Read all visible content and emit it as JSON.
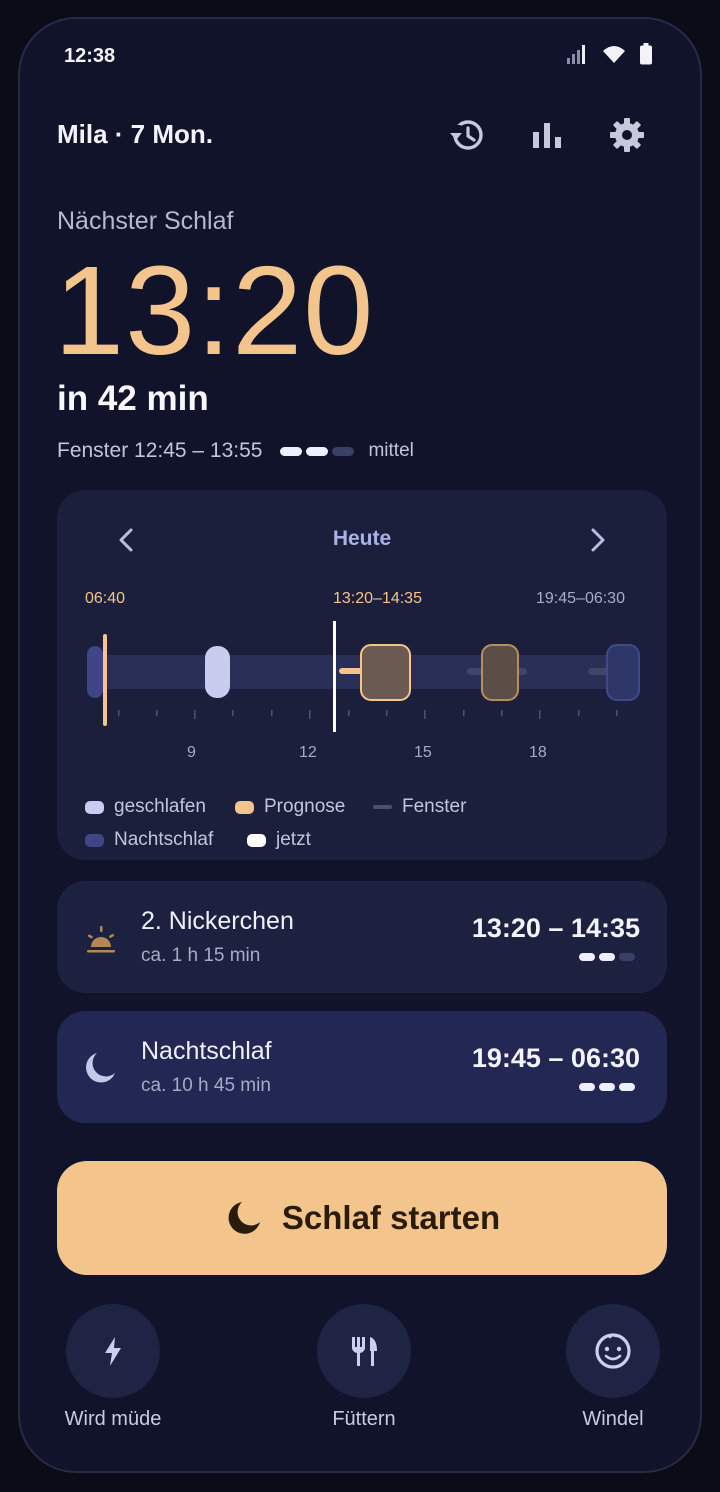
{
  "status": {
    "time": "12:38"
  },
  "header": {
    "title": "Mila · 7 Mon."
  },
  "next_sleep": {
    "label": "Nächster Schlaf",
    "time": "13:20",
    "in_text": "in 42 min",
    "window_text": "Fenster 12:45 – 13:55",
    "confidence_filled": 2,
    "confidence_total": 3,
    "confidence_label": "mittel"
  },
  "timeline": {
    "day_label": "Heute",
    "wake_label": "06:40",
    "next_nap_label": "13:20–14:35",
    "night_label": "19:45–06:30",
    "ticks": [
      "9",
      "12",
      "15",
      "18"
    ],
    "legend": {
      "slept": "geschlafen",
      "forecast": "Prognose",
      "window": "Fenster",
      "night": "Nachtschlaf",
      "now": "jetzt"
    },
    "colors": {
      "slept": "#c8cdf0",
      "forecast": "#f3c48b",
      "night": "#3e4685",
      "window": "#414668",
      "now": "#ffffff"
    }
  },
  "slots": [
    {
      "title": "2. Nickerchen",
      "sub": "ca. 1 h 15 min",
      "time": "13:20 – 14:35",
      "icon": "sunrise-icon",
      "confidence_filled": 2
    },
    {
      "title": "Nachtschlaf",
      "sub": "ca. 10 h 45 min",
      "time": "19:45 – 06:30",
      "icon": "moon-icon",
      "confidence_filled": 3
    }
  ],
  "cta": {
    "label": "Schlaf starten",
    "icon": "moon-icon",
    "color": "#f3c58c"
  },
  "quick_actions": [
    {
      "label": "Wird müde",
      "icon": "bolt-icon"
    },
    {
      "label": "Füttern",
      "icon": "fork-knife-icon"
    },
    {
      "label": "Windel",
      "icon": "baby-face-icon"
    }
  ]
}
